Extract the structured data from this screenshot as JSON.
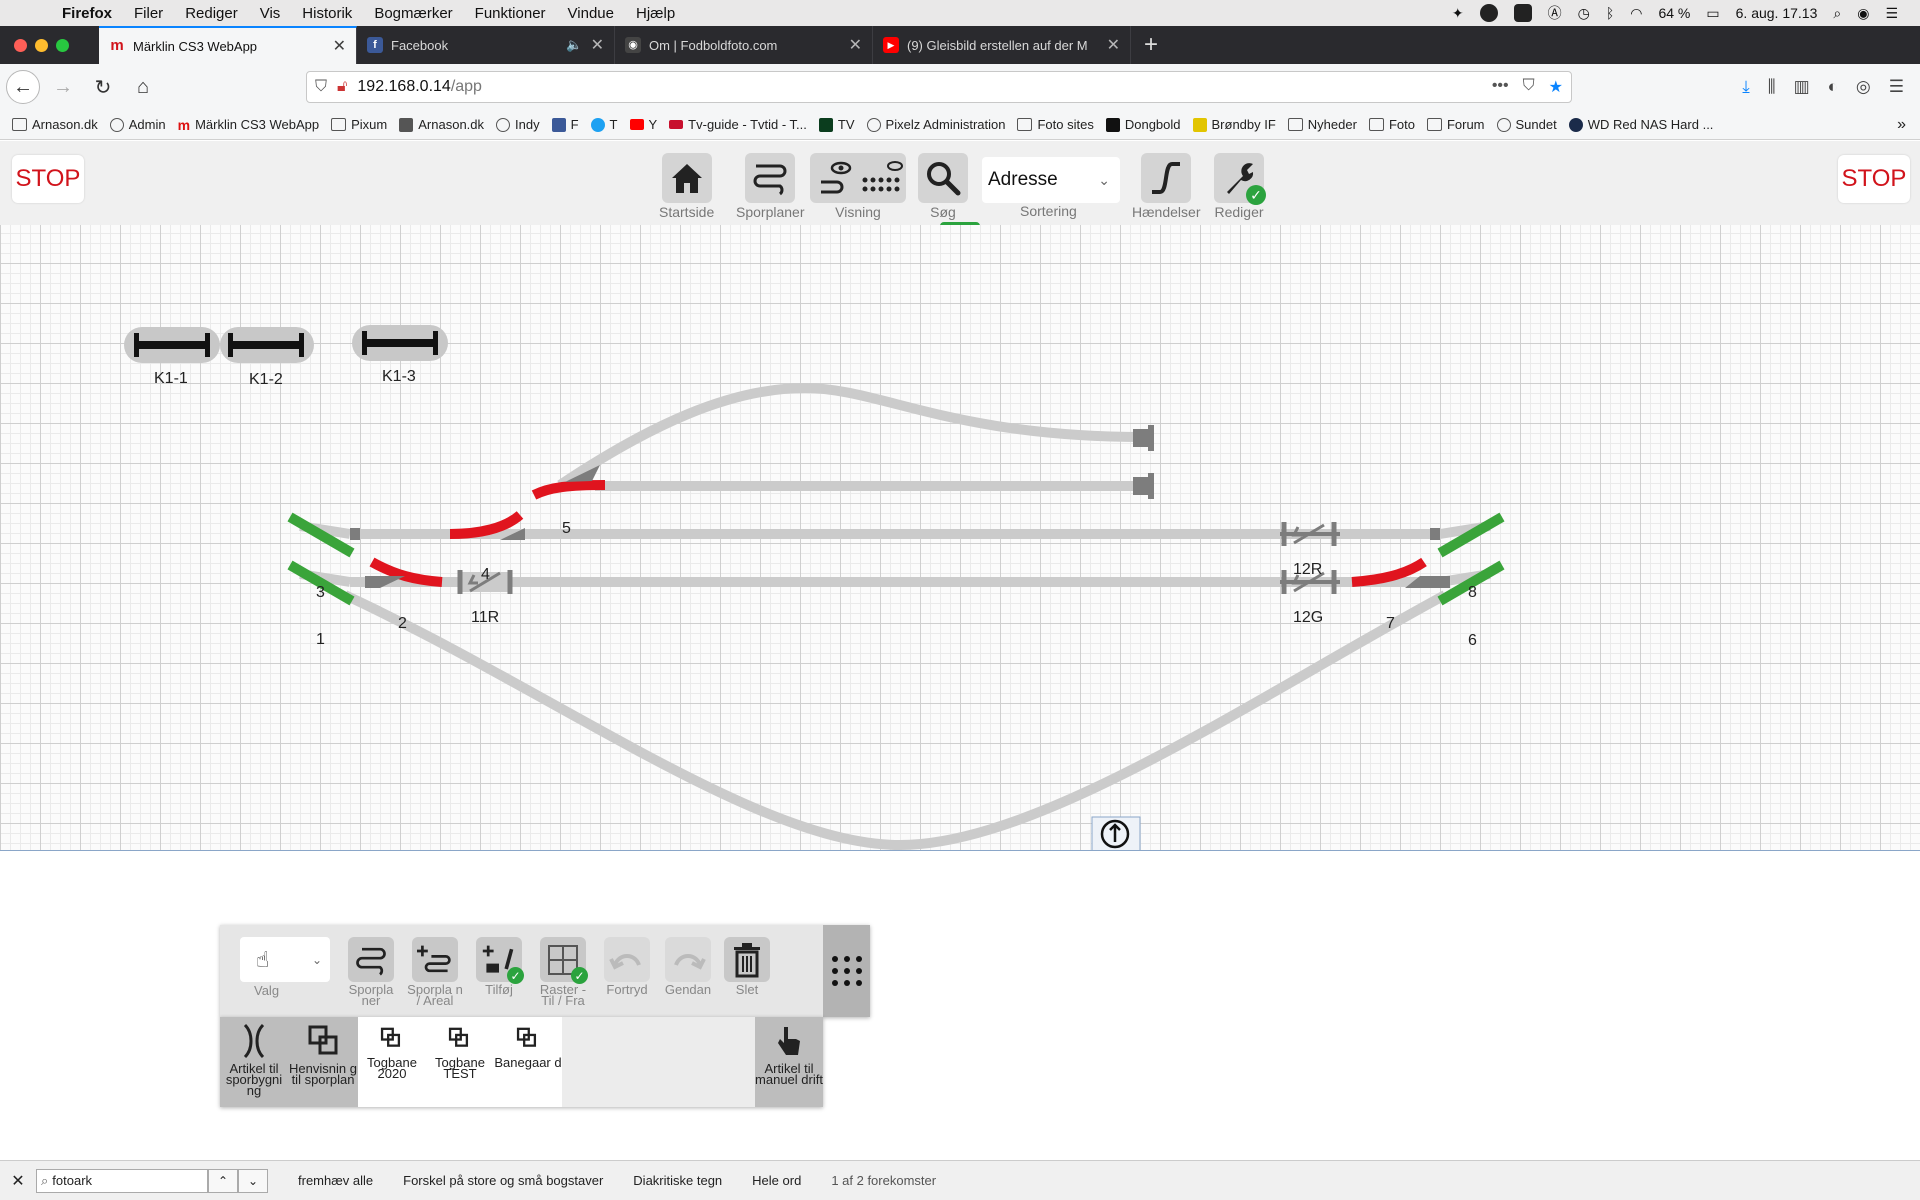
{
  "menubar": {
    "app": "Firefox",
    "items": [
      "Filer",
      "Rediger",
      "Vis",
      "Historik",
      "Bogmærker",
      "Funktioner",
      "Vindue",
      "Hjælp"
    ],
    "battery": "64 %",
    "datetime": "6. aug.  17.13"
  },
  "tabs": [
    {
      "title": "Märklin CS3 WebApp",
      "fav_color": "#d1131b",
      "fav_glyph": "m"
    },
    {
      "title": "Facebook",
      "fav_color": "#3b5998",
      "fav_glyph": "f"
    },
    {
      "title": "Om | Fodboldfoto.com",
      "fav_color": "#444444",
      "fav_glyph": "◉"
    },
    {
      "title": "(9) Gleisbild erstellen auf der M",
      "fav_color": "#ff0000",
      "fav_glyph": "▶"
    }
  ],
  "navbar": {
    "url_host": "192.168.0.14",
    "url_path": "/app"
  },
  "bookmarks": [
    {
      "label": "Arnason.dk",
      "icon": "folder"
    },
    {
      "label": "Admin",
      "icon": "globe"
    },
    {
      "label": "Märklin CS3 WebApp",
      "icon": "m"
    },
    {
      "label": "Pixum",
      "icon": "folder"
    },
    {
      "label": "Arnason.dk",
      "icon": "camera"
    },
    {
      "label": "Indy",
      "icon": "globe"
    },
    {
      "label": "F",
      "icon": "facebook"
    },
    {
      "label": "T",
      "icon": "twitter"
    },
    {
      "label": "Y",
      "icon": "youtube"
    },
    {
      "label": "Tv-guide - Tvtid - T...",
      "icon": "tv2"
    },
    {
      "label": "TV",
      "icon": "tv"
    },
    {
      "label": "Pixelz Administration",
      "icon": "pixelz"
    },
    {
      "label": "Foto sites",
      "icon": "folder"
    },
    {
      "label": "Dongbold",
      "icon": "db"
    },
    {
      "label": "Brøndby IF",
      "icon": "brondby"
    },
    {
      "label": "Nyheder",
      "icon": "folder"
    },
    {
      "label": "Foto",
      "icon": "folder"
    },
    {
      "label": "Forum",
      "icon": "folder"
    },
    {
      "label": "Sundet",
      "icon": "globe"
    },
    {
      "label": "WD Red NAS Hard ...",
      "icon": "wd"
    }
  ],
  "app": {
    "stop_left": "STOP",
    "stop_right": "STOP",
    "toolbar": {
      "home": "Startside",
      "trackplans": "Sporplaner",
      "view": "Visning",
      "search": "Søg",
      "sort_value": "Adresse",
      "sort_label": "Sortering",
      "events": "Hændelser",
      "edit": "Rediger"
    },
    "colors": {
      "accent_green": "#2ba33e",
      "stop_red": "#d1131b",
      "track_gray": "#c9c9c9",
      "signal_green": "#3aa43a",
      "switch_red": "#e0141e"
    }
  },
  "layout_labels": {
    "k1_1": "K1-1",
    "k1_2": "K1-2",
    "k1_3": "K1-3",
    "l5": "5",
    "l4": "4",
    "l3": "3",
    "l1": "1",
    "l2": "2",
    "l11r": "11R",
    "l12r": "12R",
    "l12g": "12G",
    "l8": "8",
    "l7": "7",
    "l6": "6"
  },
  "editor": {
    "select_label": "Valg",
    "tools": [
      {
        "label": "Sporpla ner"
      },
      {
        "label": "Sporpla n / Areal"
      },
      {
        "label": "Tilføj"
      },
      {
        "label": "Raster - Til / Fra"
      },
      {
        "label": "Fortryd"
      },
      {
        "label": "Gendan"
      },
      {
        "label": "Slet"
      }
    ],
    "categories": [
      {
        "label": "Artikel til sporbygni ng"
      },
      {
        "label": "Henvisnin g til sporplan"
      },
      {
        "label": "Togbane 2020"
      },
      {
        "label": "Togbane TEST"
      },
      {
        "label": "Banegaar d"
      },
      {
        "label": "Artikel til manuel drift"
      }
    ]
  },
  "findbar": {
    "query": "fotoark",
    "highlight_all": "fremhæv alle",
    "match_case": "Forskel på store og små bogstaver",
    "diacritics": "Diakritiske tegn",
    "whole_words": "Hele ord",
    "result": "1 af 2 forekomster"
  }
}
